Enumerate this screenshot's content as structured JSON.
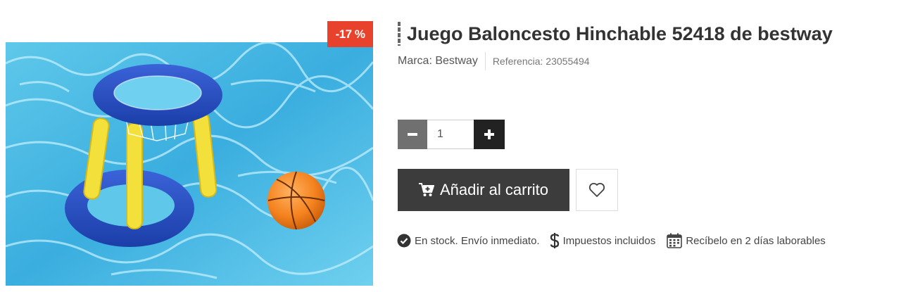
{
  "badge": {
    "discount": "-17 %",
    "color": "#e8412c"
  },
  "product": {
    "title": "Juego Baloncesto Hinchable 52418 de bestway",
    "brand": "Marca: Bestway",
    "reference": "Referencia: 23055494",
    "image_alt": "inflatable-basketball-hoop-with-ball-in-pool"
  },
  "quantity": {
    "value": "1",
    "minus_icon": "minus-icon",
    "plus_icon": "plus-icon"
  },
  "actions": {
    "add_to_cart": "Añadir al carrito",
    "cart_icon": "cart-plus-icon",
    "wishlist_icon": "heart-icon"
  },
  "info": {
    "stock": "En stock. Envío inmediato.",
    "taxes": "Impuestos incluidos",
    "delivery": "Recíbelo en 2 días laborables"
  },
  "colors": {
    "cart_button": "#3c3c3c",
    "qty_minus": "#707070",
    "qty_plus": "#222222"
  }
}
